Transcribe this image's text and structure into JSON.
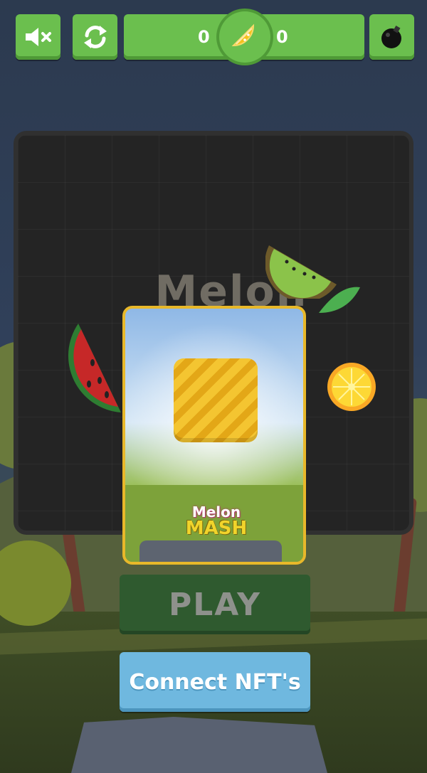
{
  "hud": {
    "score_left": "0",
    "score_right": "0",
    "icons": {
      "mute": "speaker-muted-icon",
      "restart": "restart-icon",
      "score_badge": "melon-slice-icon",
      "bomb": "bomb-icon"
    }
  },
  "board": {
    "title": "Melon"
  },
  "nft_card": {
    "logo_top": "Melon",
    "logo_bottom": "MASH"
  },
  "buttons": {
    "play": "PLAY",
    "connect": "Connect NFT's"
  },
  "colors": {
    "hud_green": "#6bbf4e",
    "play_disabled": "#2f5a2f",
    "connect_blue": "#6fb8df",
    "card_border": "#e8b82a"
  }
}
